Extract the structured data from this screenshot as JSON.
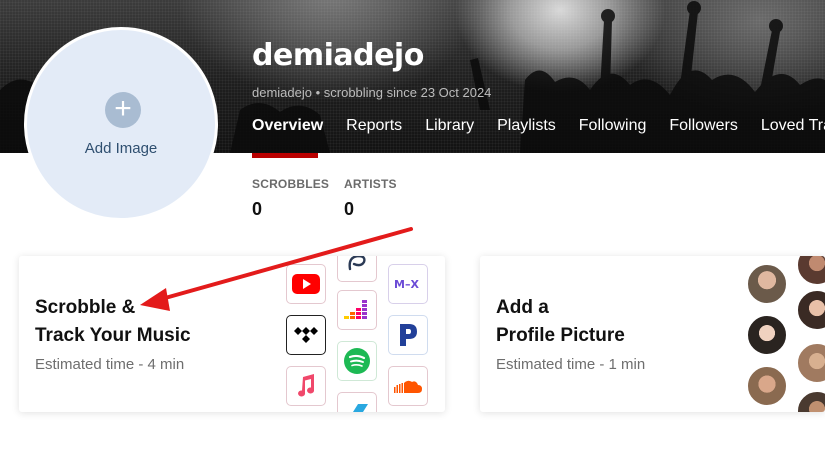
{
  "profile": {
    "username": "demiadejo",
    "subline": "demiadejo • scrobbling since 23 Oct 2024",
    "add_image_label": "Add Image"
  },
  "nav": {
    "items": [
      "Overview",
      "Reports",
      "Library",
      "Playlists",
      "Following",
      "Followers",
      "Loved Trac"
    ],
    "active": "Overview"
  },
  "stats": [
    {
      "label": "SCROBBLES",
      "value": "0"
    },
    {
      "label": "ARTISTS",
      "value": "0"
    }
  ],
  "cards": [
    {
      "title_line1": "Scrobble &",
      "title_line2": "Track Your Music",
      "subtitle": "Estimated time - 4 min",
      "icons": [
        "youtube-icon",
        "tidal-icon",
        "apple-music-icon",
        "lastfm-swirl-icon",
        "deezer-icon",
        "spotify-icon",
        "mx-icon",
        "pandora-icon",
        "soundcloud-icon",
        "partial-blue-icon"
      ]
    },
    {
      "title_line1": "Add a",
      "title_line2": "Profile Picture",
      "subtitle": "Estimated time - 1 min",
      "icons": [
        "profile-photo-faces"
      ]
    }
  ],
  "colors": {
    "accent_red": "#b90000",
    "avatar_bg": "#e3ebf7",
    "annotation_arrow": "#e31b1b"
  }
}
